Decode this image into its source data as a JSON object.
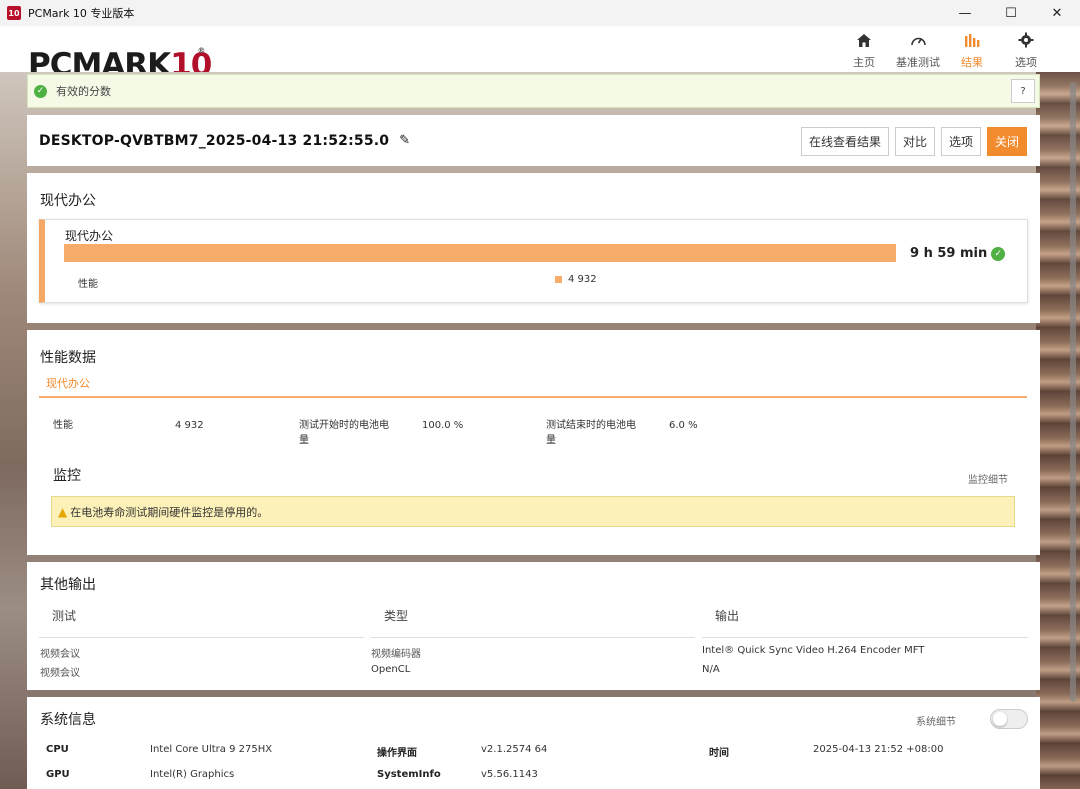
{
  "window": {
    "icon_text": "10",
    "title": "PCMark 10 专业版本",
    "minimize": "—",
    "maximize": "☐",
    "close": "✕"
  },
  "logo": {
    "text": "PCMARK",
    "num": "10",
    "reg": "®"
  },
  "nav": [
    {
      "label": "主页",
      "icon": "home-icon"
    },
    {
      "label": "基准测试",
      "icon": "gauge-icon"
    },
    {
      "label": "结果",
      "icon": "bar-chart-icon"
    },
    {
      "label": "选项",
      "icon": "gear-icon"
    }
  ],
  "accent": "#f28a2e",
  "valid": {
    "text": "有效的分数",
    "help": "?"
  },
  "result": {
    "title": "DESKTOP-QVBTBM7_2025-04-13 21:52:55.0",
    "buttons": {
      "online": "在线查看结果",
      "compare": "对比",
      "options": "选项",
      "close": "关闭"
    }
  },
  "office": {
    "section_title": "现代办公",
    "card_title": "现代办公",
    "duration": "9 h 59 min",
    "perf_label": "性能",
    "perf_value": "4 932"
  },
  "perfdata": {
    "section_title": "性能数据",
    "tab": "现代办公",
    "rows": {
      "perf_key": "性能",
      "perf_val": "4 932",
      "start_key_1": "测试开始时的电池电",
      "start_key_2": "量",
      "start_val": "100.0 %",
      "end_key_1": "测试结束时的电池电",
      "end_key_2": "量",
      "end_val": "6.0 %"
    },
    "monitor_title": "监控",
    "monitor_link": "监控细节",
    "warning": "在电池寿命测试期间硬件监控是停用的。"
  },
  "other": {
    "section_title": "其他输出",
    "headers": [
      "测试",
      "类型",
      "输出"
    ],
    "rows": [
      [
        "视频会议",
        "视频编码器",
        "Intel® Quick Sync Video H.264 Encoder MFT"
      ],
      [
        "视频会议",
        "OpenCL",
        "N/A"
      ]
    ]
  },
  "sysinfo": {
    "section_title": "系统信息",
    "toggle_label": "系统细节",
    "items": {
      "cpu_k": "CPU",
      "cpu_v": "Intel Core Ultra 9 275HX",
      "os_k": "操作界面",
      "os_v": "v2.1.2574 64",
      "time_k": "时间",
      "time_v": "2025-04-13 21:52 +08:00",
      "gpu_k": "GPU",
      "gpu_v": "Intel(R) Graphics",
      "si_k": "SystemInfo",
      "si_v": "v5.56.1143"
    }
  }
}
